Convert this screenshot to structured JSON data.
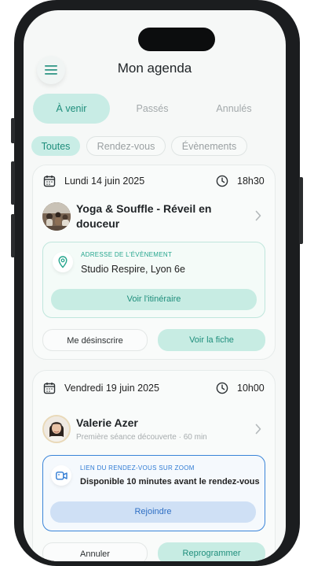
{
  "header": {
    "title": "Mon agenda"
  },
  "tabs": [
    {
      "label": "À venir",
      "active": true
    },
    {
      "label": "Passés",
      "active": false
    },
    {
      "label": "Annulés",
      "active": false
    }
  ],
  "filters": [
    {
      "label": "Toutes",
      "active": true
    },
    {
      "label": "Rendez-vous",
      "active": false
    },
    {
      "label": "Évènements",
      "active": false
    }
  ],
  "cards": [
    {
      "date": "Lundi 14 juin 2025",
      "time": "18h30",
      "title_line1": "Yoga & Souffle - Réveil en",
      "title_line2": "douceur",
      "info_label": "ADRESSE DE L'ÉVÈNEMENT",
      "info_value": "Studio Respire, Lyon 6e",
      "info_action": "Voir l'itinéraire",
      "secondary_action": "Me désinscrire",
      "primary_action": "Voir la fiche"
    },
    {
      "date": "Vendredi 19 juin 2025",
      "time": "10h00",
      "title": "Valerie Azer",
      "subtitle": "Première séance découverte · 60 min",
      "info_label": "LIEN DU RENDEZ-VOUS SUR ZOOM",
      "info_value": "Disponible 10 minutes avant le rendez-vous",
      "info_action": "Rejoindre",
      "secondary_action": "Annuler",
      "primary_action": "Reprogrammer"
    }
  ],
  "colors": {
    "accent": "#1f8e7c",
    "accent_bg": "#c8ece5",
    "zoom_blue": "#2f7bd4",
    "zoom_btn_bg": "#cfe0f5"
  }
}
